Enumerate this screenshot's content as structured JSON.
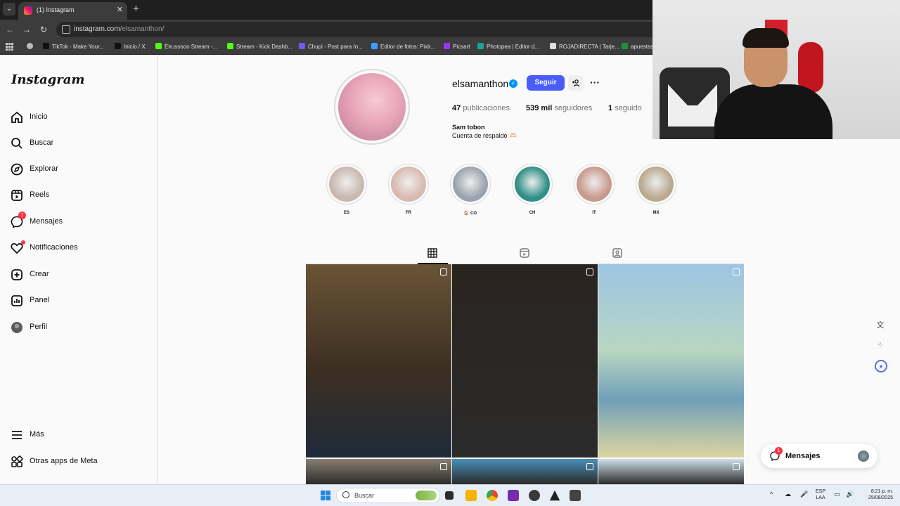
{
  "browser": {
    "tab_title": "(1) Instagram",
    "url_host": "instagram.com",
    "url_path": "/elsamanthon/",
    "bookmarks": [
      {
        "label": "TikTok - Make Your...",
        "color": "#111111"
      },
      {
        "label": "Inicio / X",
        "color": "#111111"
      },
      {
        "label": "Elrussooo Stream -...",
        "color": "#53fc18"
      },
      {
        "label": "Stream - Kick Dashb...",
        "color": "#53fc18"
      },
      {
        "label": "Chupi - Post para In...",
        "color": "#6c5ce7"
      },
      {
        "label": "Editor de fotos: Pixlr...",
        "color": "#3aa0ff"
      },
      {
        "label": "Picsart",
        "color": "#9b34ef"
      },
      {
        "label": "Photopea | Editor d...",
        "color": "#18a497"
      },
      {
        "label": "ROJADIRECTA | Tarje...",
        "color": "#dddddd"
      },
      {
        "label": "apuestas",
        "color": "#1d8f3a"
      }
    ]
  },
  "sidebar": {
    "logo": "Instagram",
    "items": [
      {
        "label": "Inicio",
        "icon": "home-icon"
      },
      {
        "label": "Buscar",
        "icon": "search-icon"
      },
      {
        "label": "Explorar",
        "icon": "compass-icon"
      },
      {
        "label": "Reels",
        "icon": "reels-icon"
      },
      {
        "label": "Mensajes",
        "icon": "messenger-icon",
        "badge": "1"
      },
      {
        "label": "Notificaciones",
        "icon": "heart-icon"
      },
      {
        "label": "Crear",
        "icon": "plus-square-icon"
      },
      {
        "label": "Panel",
        "icon": "chart-icon"
      },
      {
        "label": "Perfil",
        "icon": "avatar-icon"
      }
    ],
    "bottom_items": [
      {
        "label": "Más",
        "icon": "menu-icon"
      },
      {
        "label": "Otras apps de Meta",
        "icon": "meta-apps-icon"
      }
    ]
  },
  "profile": {
    "username": "elsamanthon",
    "follow_label": "Seguir",
    "posts_count": "47",
    "posts_label": "publicaciones",
    "followers_count": "539 mil",
    "followers_label": "seguidores",
    "following_count": "1",
    "following_label": "seguido",
    "bio_name": "Sam tobon",
    "bio_text": "Cuenta de respaldo 🫶🏻"
  },
  "highlights": [
    {
      "label": "ES",
      "color": "#c8b8b0"
    },
    {
      "label": "FR",
      "color": "#d9b9b0"
    },
    {
      "label": "🏠 CO",
      "color": "#9aa3ad"
    },
    {
      "label": "CH",
      "color": "#2f8f88"
    },
    {
      "label": "IT",
      "color": "#c89a8c"
    },
    {
      "label": "MX",
      "color": "#b9a98f"
    }
  ],
  "posts": [
    {
      "bg": "#4a3b28"
    },
    {
      "bg": "#2a2420"
    },
    {
      "bg": "#7faed0"
    },
    {
      "bg": "#8a7e73"
    },
    {
      "bg": "#4a8fb8"
    },
    {
      "bg": "#cfe0ea"
    }
  ],
  "floating_messages": {
    "label": "Mensajes",
    "badge": "1"
  },
  "taskbar": {
    "search_placeholder": "Buscar",
    "lang_top": "ESP",
    "lang_bottom": "LAA",
    "time": "8:21 p. m.",
    "date": "25/08/2025"
  }
}
